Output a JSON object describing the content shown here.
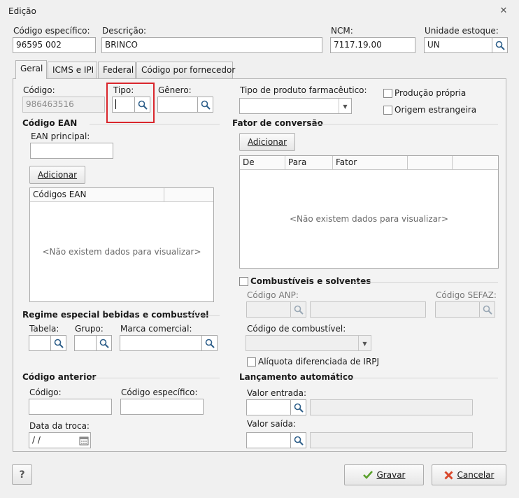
{
  "window": {
    "title": "Edição"
  },
  "header": {
    "codigo_especifico_label": "Código específico:",
    "codigo_especifico_value": "96595   002",
    "descricao_label": "Descrição:",
    "descricao_value": "BRINCO",
    "ncm_label": "NCM:",
    "ncm_value": "7117.19.00",
    "unidade_label": "Unidade estoque:",
    "unidade_value": "UN"
  },
  "tabs": [
    {
      "label": "Geral"
    },
    {
      "label": "ICMS e IPI"
    },
    {
      "label": "Federal"
    },
    {
      "label": "Código por fornecedor"
    }
  ],
  "geral": {
    "codigo_label": "Código:",
    "codigo_value": "986463516",
    "tipo_label": "Tipo:",
    "genero_label": "Gênero:",
    "tipo_farma_label": "Tipo de produto farmacêutico:",
    "producao_propria_label": "Produção própria",
    "origem_estrangeira_label": "Origem estrangeira",
    "ean_section": "Código EAN",
    "ean_principal_label": "EAN principal:",
    "ean_add_button": "Adicionar",
    "ean_grid_header": "Códigos EAN",
    "ean_empty": "<Não existem dados para visualizar>",
    "fator_section": "Fator de conversão",
    "fator_add_button": "Adicionar",
    "fator_headers": [
      "De",
      "Para",
      "Fator",
      "",
      ""
    ],
    "fator_empty": "<Não existem dados para visualizar>",
    "regime_section": "Regime especial bebidas e combustível",
    "tabela_label": "Tabela:",
    "grupo_label": "Grupo:",
    "marca_label": "Marca comercial:",
    "combustiveis_label": "Combustíveis e solventes",
    "codigo_anp_label": "Código ANP:",
    "codigo_sefaz_label": "Código SEFAZ:",
    "codigo_combustivel_label": "Código de combustível:",
    "aliquota_label": "Alíquota diferenciada de IRPJ",
    "anterior_section": "Código anterior",
    "anterior_codigo_label": "Código:",
    "anterior_codigo_especifico_label": "Código específico:",
    "data_troca_label": "Data da troca:",
    "data_troca_value": " /  /",
    "lancamento_section": "Lançamento automático",
    "valor_entrada_label": "Valor entrada:",
    "valor_saida_label": "Valor saída:"
  },
  "footer": {
    "help_label": "?",
    "gravar_label": "Gravar",
    "cancelar_label": "Cancelar"
  },
  "colors": {
    "highlight": "#d9262c",
    "check_green": "#5aa02c",
    "cancel_red": "#d9482c"
  },
  "icons": [
    "close-icon",
    "search-icon",
    "calendar-icon",
    "check-icon",
    "cancel-icon",
    "dropdown-arrow-icon"
  ]
}
